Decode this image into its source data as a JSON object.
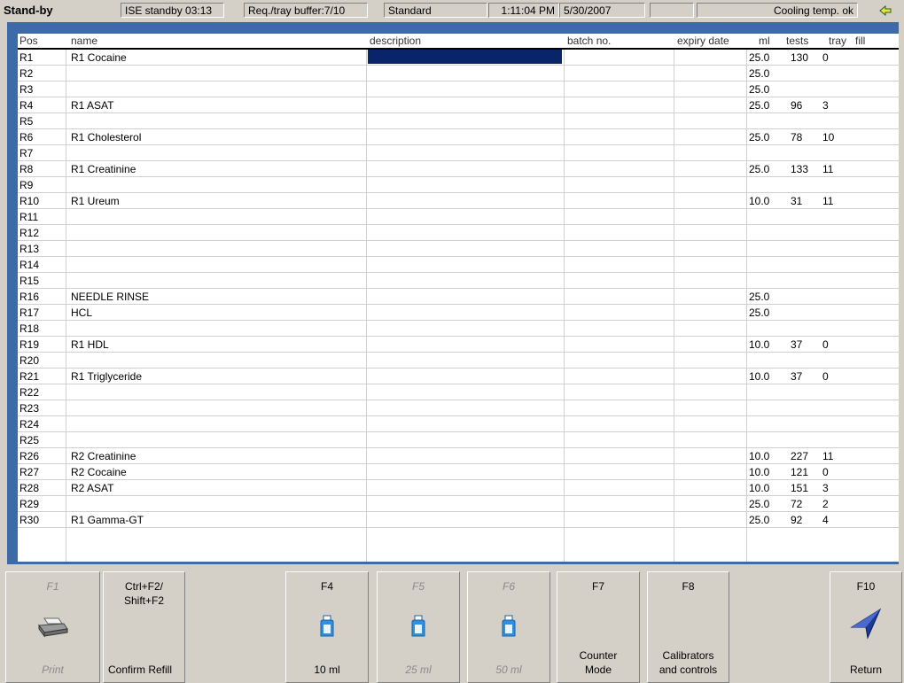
{
  "status": {
    "mode": "Stand-by",
    "ise": "ISE standby 03:13",
    "buffer": "Req./tray buffer:7/10",
    "profile": "Standard",
    "time": "1:11:04 PM",
    "date": "5/30/2007",
    "empty": "",
    "cooling": "Cooling temp. ok"
  },
  "colors": {
    "frame": "#3e6aa8",
    "selection": "#0a246a",
    "icon_bottle": "#2f8fe0"
  },
  "table": {
    "headers": {
      "pos": "Pos",
      "name": "name",
      "description": "description",
      "batch": "batch no.",
      "expiry": "expiry date",
      "ml": "ml",
      "tests": "tests",
      "tray": "tray",
      "fill": "fill"
    },
    "rows": [
      {
        "pos": "R1",
        "name": "R1 Cocaine",
        "ml": "25.0",
        "tests": "130",
        "tray": "0"
      },
      {
        "pos": "R2",
        "name": "",
        "ml": "25.0",
        "tests": "",
        "tray": ""
      },
      {
        "pos": "R3",
        "name": "",
        "ml": "25.0",
        "tests": "",
        "tray": ""
      },
      {
        "pos": "R4",
        "name": "R1 ASAT",
        "ml": "25.0",
        "tests": "96",
        "tray": "3"
      },
      {
        "pos": "R5",
        "name": "",
        "ml": "",
        "tests": "",
        "tray": ""
      },
      {
        "pos": "R6",
        "name": "R1 Cholesterol",
        "ml": "25.0",
        "tests": "78",
        "tray": "10"
      },
      {
        "pos": "R7",
        "name": "",
        "ml": "",
        "tests": "",
        "tray": ""
      },
      {
        "pos": "R8",
        "name": "R1 Creatinine",
        "ml": "25.0",
        "tests": "133",
        "tray": "11"
      },
      {
        "pos": "R9",
        "name": "",
        "ml": "",
        "tests": "",
        "tray": ""
      },
      {
        "pos": "R10",
        "name": "R1 Ureum",
        "ml": "10.0",
        "tests": "31",
        "tray": "11"
      },
      {
        "pos": "R11",
        "name": "",
        "ml": "",
        "tests": "",
        "tray": ""
      },
      {
        "pos": "R12",
        "name": "",
        "ml": "",
        "tests": "",
        "tray": ""
      },
      {
        "pos": "R13",
        "name": "",
        "ml": "",
        "tests": "",
        "tray": ""
      },
      {
        "pos": "R14",
        "name": "",
        "ml": "",
        "tests": "",
        "tray": ""
      },
      {
        "pos": "R15",
        "name": "",
        "ml": "",
        "tests": "",
        "tray": ""
      },
      {
        "pos": "R16",
        "name": "NEEDLE RINSE",
        "ml": "25.0",
        "tests": "",
        "tray": ""
      },
      {
        "pos": "R17",
        "name": "HCL",
        "ml": "25.0",
        "tests": "",
        "tray": ""
      },
      {
        "pos": "R18",
        "name": "",
        "ml": "",
        "tests": "",
        "tray": ""
      },
      {
        "pos": "R19",
        "name": "R1 HDL",
        "ml": "10.0",
        "tests": "37",
        "tray": "0"
      },
      {
        "pos": "R20",
        "name": "",
        "ml": "",
        "tests": "",
        "tray": ""
      },
      {
        "pos": "R21",
        "name": "R1 Triglyceride",
        "ml": "10.0",
        "tests": "37",
        "tray": "0"
      },
      {
        "pos": "R22",
        "name": "",
        "ml": "",
        "tests": "",
        "tray": ""
      },
      {
        "pos": "R23",
        "name": "",
        "ml": "",
        "tests": "",
        "tray": ""
      },
      {
        "pos": "R24",
        "name": "",
        "ml": "",
        "tests": "",
        "tray": ""
      },
      {
        "pos": "R25",
        "name": "",
        "ml": "",
        "tests": "",
        "tray": ""
      },
      {
        "pos": "R26",
        "name": "R2 Creatinine",
        "ml": "10.0",
        "tests": "227",
        "tray": "11"
      },
      {
        "pos": "R27",
        "name": "R2 Cocaine",
        "ml": "10.0",
        "tests": "121",
        "tray": "0"
      },
      {
        "pos": "R28",
        "name": "R2 ASAT",
        "ml": "10.0",
        "tests": "151",
        "tray": "3"
      },
      {
        "pos": "R29",
        "name": "",
        "ml": "25.0",
        "tests": "72",
        "tray": "2"
      },
      {
        "pos": "R30",
        "name": "R1 Gamma-GT",
        "ml": "25.0",
        "tests": "92",
        "tray": "4"
      }
    ]
  },
  "fkeys": {
    "f1": {
      "key": "F1",
      "label": "Print",
      "icon": "printer-icon"
    },
    "f2": {
      "key": "Ctrl+F2/\nShift+F2",
      "label": "Confirm Refill"
    },
    "f4": {
      "key": "F4",
      "label": "10 ml",
      "icon": "bottle-icon"
    },
    "f5": {
      "key": "F5",
      "label": "25 ml",
      "icon": "bottle-icon"
    },
    "f6": {
      "key": "F6",
      "label": "50 ml",
      "icon": "bottle-icon"
    },
    "f7": {
      "key": "F7",
      "label": "Counter\nMode"
    },
    "f8": {
      "key": "F8",
      "label": "Calibrators\nand controls"
    },
    "f10": {
      "key": "F10",
      "label": "Return",
      "icon": "arrow-icon"
    }
  }
}
